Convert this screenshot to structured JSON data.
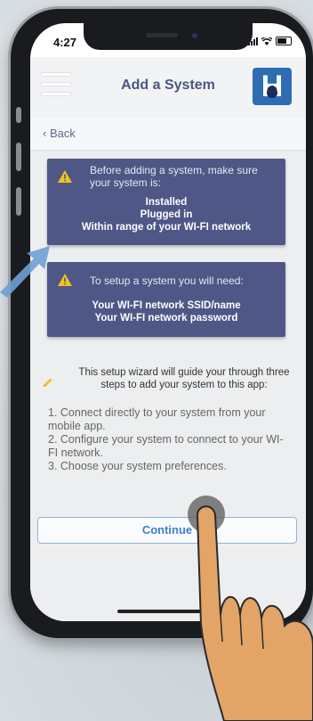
{
  "status_bar": {
    "time": "4:27"
  },
  "header": {
    "title": "Add a System",
    "logo_letter": "H"
  },
  "nav": {
    "back_label": "Back"
  },
  "card_requirements": {
    "intro": "Before adding a system, make sure your system is:",
    "items": [
      "Installed",
      "Plugged in",
      "Within range of your WI-FI network"
    ]
  },
  "card_needs": {
    "intro": "To setup a system you will need:",
    "items": [
      "Your WI-FI network SSID/name",
      "Your WI-FI network password"
    ]
  },
  "wizard": {
    "intro": "This setup wizard will guide your through three steps to add your system to this app:",
    "steps": [
      "1. Connect directly to your system from your mobile app.",
      "2. Configure your system to connect to your WI-FI network.",
      "3. Choose your system preferences."
    ]
  },
  "actions": {
    "continue_label": "Continue"
  },
  "colors": {
    "card_bg": "#4e5786",
    "warning": "#f3c21b",
    "accent": "#3f7fc4",
    "title": "#4a5680",
    "logo": "#2e6db4"
  },
  "icons": [
    "menu-icon",
    "logo-icon",
    "chevron-left-icon",
    "warning-icon",
    "pencil-icon",
    "hand-pointer-icon",
    "arrow-icon"
  ]
}
